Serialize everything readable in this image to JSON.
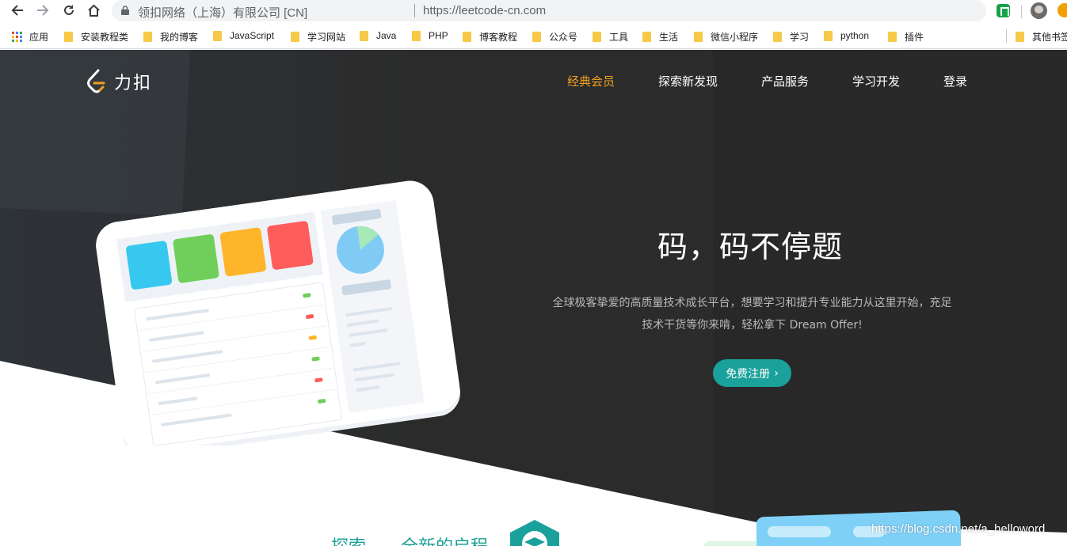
{
  "browser": {
    "site_label": "领扣网络（上海）有限公司 [CN]",
    "url": "https://leetcode-cn.com",
    "bookmarks": [
      {
        "label": "应用",
        "type": "apps"
      },
      {
        "label": "安装教程类",
        "type": "folder"
      },
      {
        "label": "我的博客",
        "type": "folder"
      },
      {
        "label": "JavaScript",
        "type": "folder"
      },
      {
        "label": "学习网站",
        "type": "folder"
      },
      {
        "label": "Java",
        "type": "folder"
      },
      {
        "label": "PHP",
        "type": "folder"
      },
      {
        "label": "博客教程",
        "type": "folder"
      },
      {
        "label": "公众号",
        "type": "folder"
      },
      {
        "label": "工具",
        "type": "folder"
      },
      {
        "label": "生活",
        "type": "folder"
      },
      {
        "label": "微信小程序",
        "type": "folder"
      },
      {
        "label": "学习",
        "type": "folder"
      },
      {
        "label": "python",
        "type": "folder"
      },
      {
        "label": "插件",
        "type": "folder"
      },
      {
        "label": "其他书签",
        "type": "folder"
      }
    ]
  },
  "header": {
    "logo_text": "力扣",
    "nav": [
      "经典会员",
      "探索新发现",
      "产品服务",
      "学习开发",
      "登录"
    ],
    "active_color": "#f0a020"
  },
  "hero": {
    "headline": "码，码不停题",
    "subtext": "全球极客挚爱的高质量技术成长平台，想要学习和提升专业能力从这里开始，充足技术干货等你来啃，轻松拿下 Dream Offer!",
    "cta_label": "免费注册",
    "cta_color": "#1aa19b"
  },
  "explore": {
    "word1": "探索",
    "word2": "全新的启程"
  },
  "watermark": "https://blog.csdn.net/a_helloword"
}
